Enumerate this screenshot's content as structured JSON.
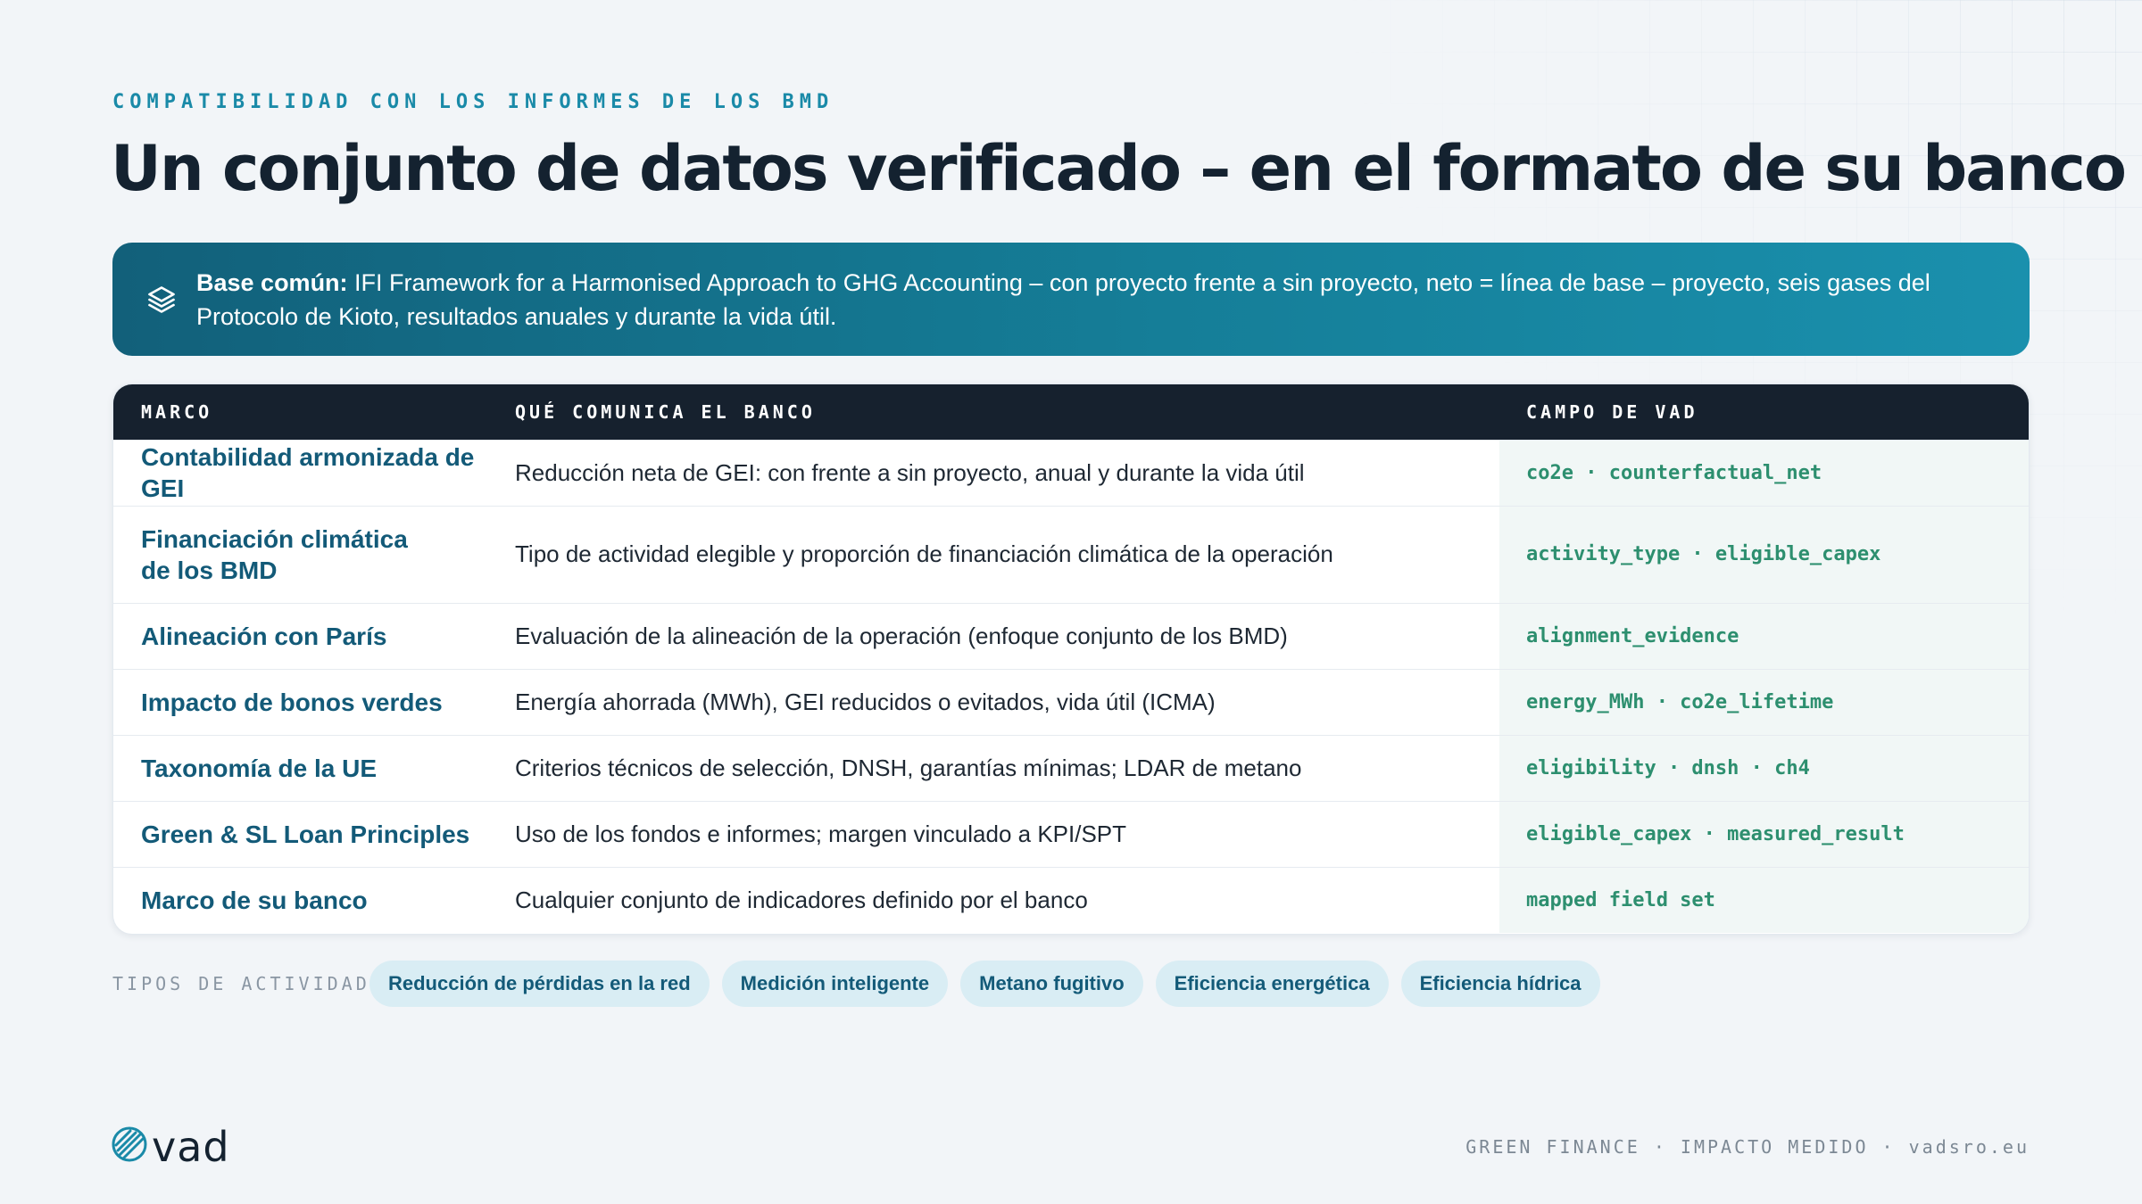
{
  "eyebrow": "COMPATIBILIDAD CON LOS INFORMES DE LOS BMD",
  "title": "Un conjunto de datos verificado – en el formato de su banco",
  "banner": {
    "icon": "layers-icon",
    "label": "Base común:",
    "text": " IFI Framework for a Harmonised Approach to GHG Accounting – con proyecto frente a sin proyecto, neto = línea de base – proyecto, seis gases del Protocolo de Kioto, resultados anuales y durante la vida útil."
  },
  "table": {
    "headers": [
      "MARCO",
      "QUÉ COMUNICA EL BANCO",
      "CAMPO DE VAD"
    ],
    "rows": [
      {
        "framework": "Contabilidad armonizada de GEI",
        "communicates": "Reducción neta de GEI: con frente a sin proyecto, anual y durante la vida útil",
        "field": "co2e · counterfactual_net"
      },
      {
        "framework": "Financiación climática\nde los BMD",
        "communicates": "Tipo de actividad elegible y proporción de financiación climática de la operación",
        "field": "activity_type · eligible_capex"
      },
      {
        "framework": "Alineación con París",
        "communicates": "Evaluación de la alineación de la operación (enfoque conjunto de los BMD)",
        "field": "alignment_evidence"
      },
      {
        "framework": "Impacto de bonos verdes",
        "communicates": "Energía ahorrada (MWh), GEI reducidos o evitados, vida útil (ICMA)",
        "field": "energy_MWh · co2e_lifetime"
      },
      {
        "framework": "Taxonomía de la UE",
        "communicates": "Criterios técnicos de selección, DNSH, garantías mínimas; LDAR de metano",
        "field": "eligibility · dnsh · ch4"
      },
      {
        "framework": "Green & SL Loan Principles",
        "communicates": "Uso de los fondos e informes; margen vinculado a KPI/SPT",
        "field": "eligible_capex · measured_result"
      },
      {
        "framework": "Marco de su banco",
        "communicates": "Cualquier conjunto de indicadores definido por el banco",
        "field": "mapped field set"
      }
    ]
  },
  "activity_types": {
    "label": "TIPOS DE ACTIVIDAD",
    "chips": [
      "Reducción de pérdidas en la red",
      "Medición inteligente",
      "Metano fugitivo",
      "Eficiencia energética",
      "Eficiencia hídrica"
    ]
  },
  "footer": {
    "logo_text": "vad",
    "right": "GREEN FINANCE · IMPACTO MEDIDO · vadsro.eu"
  },
  "colors": {
    "accent": "#1a8aa8",
    "banner": "#157e98",
    "header_bg": "#16212e",
    "framework_text": "#135a78",
    "field_text": "#2d8f6f",
    "chip_bg": "#d9edf4"
  }
}
